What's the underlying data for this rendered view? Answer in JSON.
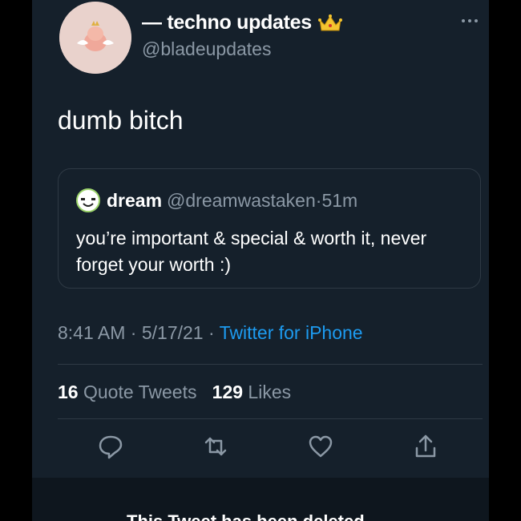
{
  "tweet": {
    "display_name": "— techno updates",
    "badge_icon": "crown-icon",
    "handle": "@bladeupdates",
    "text": "dumb bitch",
    "time": "8:41 AM",
    "date": "5/17/21",
    "source": "Twitter for iPhone",
    "separator": " · "
  },
  "quote": {
    "name": "dream",
    "handle": "@dreamwastaken",
    "age": "51m",
    "text": "you’re important & special & worth it, never forget your worth :)"
  },
  "stats": {
    "quote_count": "16",
    "quote_label": "Quote Tweets",
    "like_count": "129",
    "like_label": "Likes"
  },
  "actions": [
    "reply-icon",
    "retweet-icon",
    "like-icon",
    "share-icon"
  ],
  "footer": {
    "deleted_notice": "This Tweet has been deleted"
  },
  "colors": {
    "background": "#15202b",
    "accent": "#1d9bf0",
    "secondary_text": "#8b98a5"
  }
}
